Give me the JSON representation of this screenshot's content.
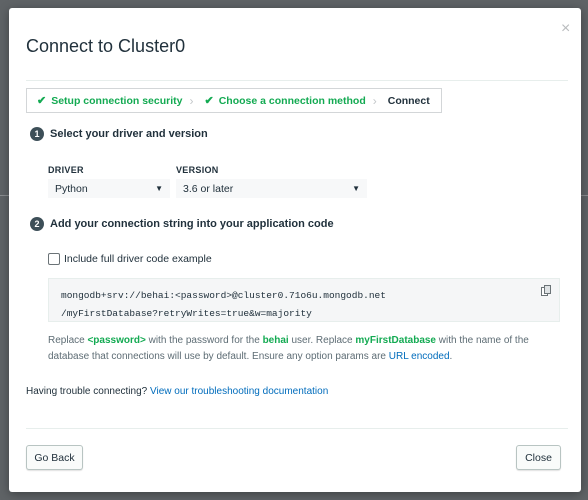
{
  "dialog": {
    "title": "Connect to Cluster0",
    "close_glyph": "×"
  },
  "wizard": {
    "steps": [
      {
        "label": "Setup connection security",
        "state": "done"
      },
      {
        "label": "Choose a connection method",
        "state": "done"
      },
      {
        "label": "Connect",
        "state": "current"
      }
    ],
    "check_glyph": "✔",
    "separator_glyph": "›"
  },
  "section1": {
    "number": "1",
    "title": "Select your driver and version"
  },
  "driver": {
    "label": "DRIVER",
    "value": "Python"
  },
  "version": {
    "label": "VERSION",
    "value": "3.6 or later"
  },
  "caret_glyph": "▼",
  "section2": {
    "number": "2",
    "title": "Add your connection string into your application code"
  },
  "include_full_code": {
    "label": "Include full driver code example",
    "checked": false
  },
  "connection_string": {
    "line1": "mongodb+srv://behai:<password>@cluster0.71o6u.mongodb.net",
    "line2": "/myFirstDatabase?retryWrites=true&w=majority",
    "copy_icon": "copy-icon"
  },
  "help_text": {
    "p1": "Replace ",
    "password": "<password>",
    "p2": " with the password for the ",
    "user": "behai",
    "p3": " user. Replace ",
    "db": "myFirstDatabase",
    "p4": " with the name of the database that connections will use by default. Ensure any option params are ",
    "url_encoded": "URL encoded",
    "p5": "."
  },
  "trouble": {
    "text": "Having trouble connecting? ",
    "link": "View our troubleshooting documentation"
  },
  "footer": {
    "back_label": "Go Back",
    "close_label": "Close"
  },
  "colors": {
    "accent_green": "#13aa52",
    "link_blue": "#006cbc",
    "text_dark": "#21313c"
  }
}
